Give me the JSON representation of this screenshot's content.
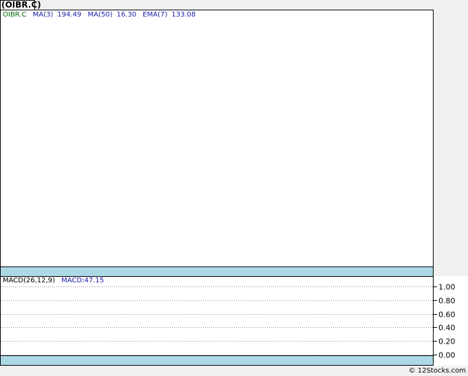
{
  "title": "(OIBR.C)",
  "price_legend": {
    "symbol": "OIBR.C",
    "ma3_label": "MA(3)",
    "ma3_value": "194.49",
    "ma50_label": "MA(50)",
    "ma50_value": "16.30",
    "ema7_label": "EMA(7)",
    "ema7_value": "133.08"
  },
  "macd_legend": {
    "label": "MACD(26,12,9)",
    "value_text": "MACD:47.15"
  },
  "footer": "© 12Stocks.com",
  "colors": {
    "band": "#add8e6",
    "legend_symbol": "#006400",
    "legend_values": "#1a1aaa"
  },
  "chart_data": [
    {
      "type": "line",
      "title": "",
      "series": []
    },
    {
      "type": "line",
      "title": "",
      "series": [],
      "ylim": [
        0.0,
        1.0
      ],
      "yticks": [
        "1.00",
        "0.80",
        "0.60",
        "0.40",
        "0.20",
        "0.00"
      ],
      "grid": true
    }
  ]
}
